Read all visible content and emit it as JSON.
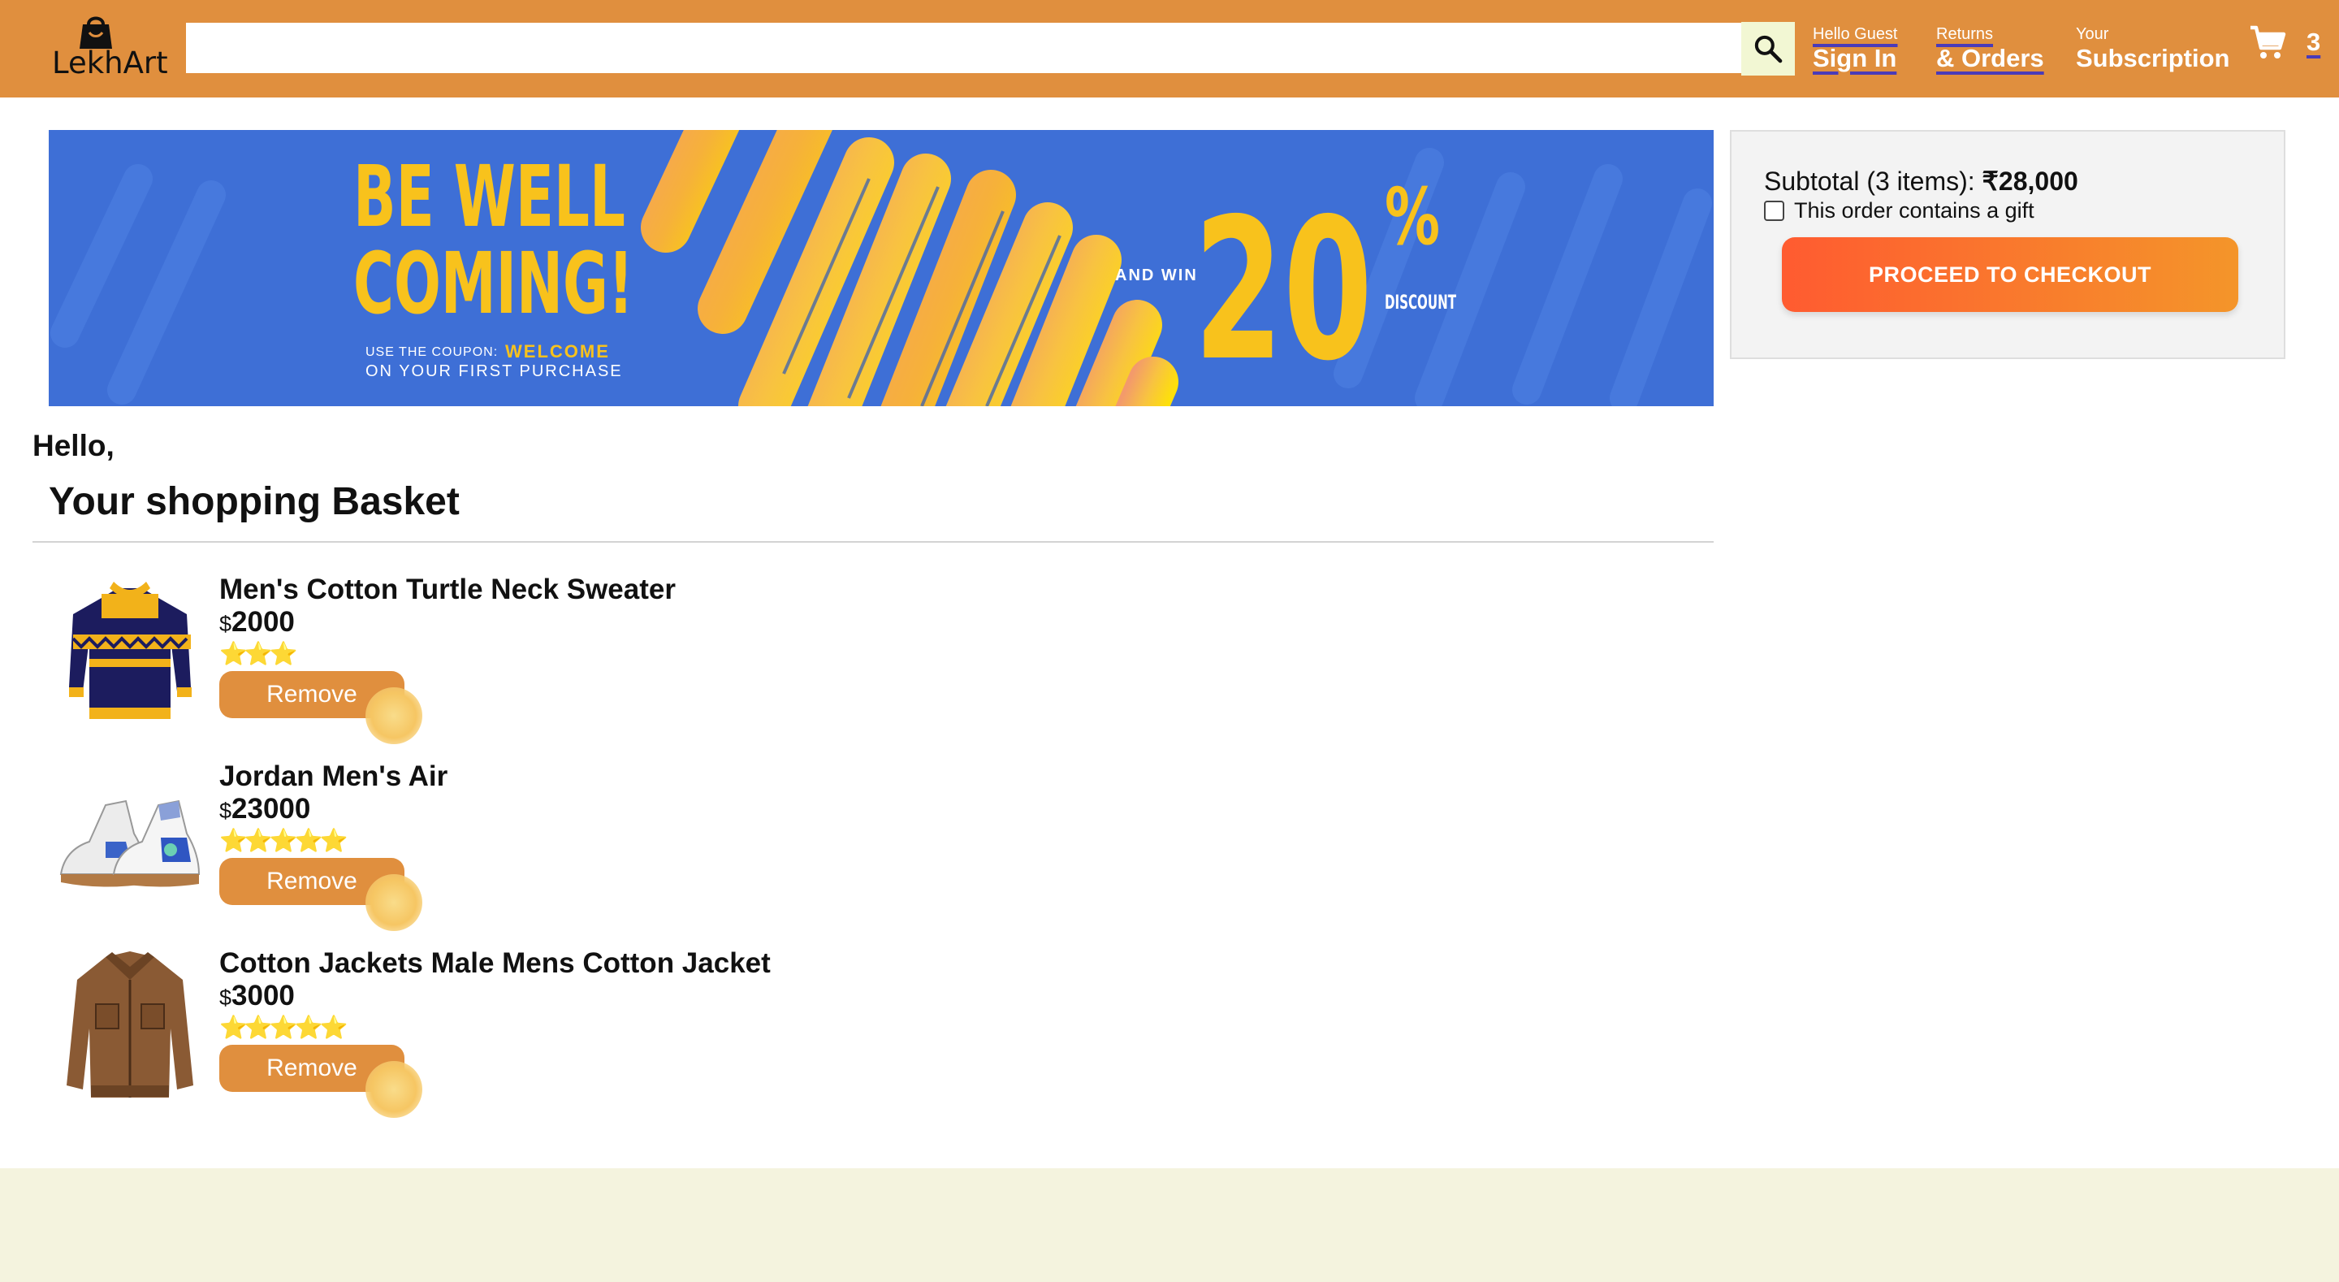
{
  "header": {
    "logo_text": "LekhArt",
    "search": {
      "value": "",
      "placeholder": ""
    },
    "nav": [
      {
        "small": "Hello Guest",
        "big": "Sign In"
      },
      {
        "small": "Returns",
        "big": "& Orders"
      },
      {
        "small": "Your",
        "big": "Subscription"
      }
    ],
    "cart_count": "3"
  },
  "banner": {
    "line1": "BE WELL",
    "line2": "COMING!",
    "coupon_prefix": "USE THE COUPON:",
    "coupon_code": "WELCOME",
    "coupon_suffix": "ON YOUR FIRST PURCHASE",
    "and_win": "AND WIN",
    "percent_value": "20",
    "percent_sign": "%",
    "discount": "DISCOUNT"
  },
  "subtotal": {
    "label": "Subtotal (3 items):",
    "amount": "₹28,000",
    "gift_label": "This order contains a gift",
    "checkout_label": "PROCEED TO CHECKOUT"
  },
  "greeting": "Hello,",
  "basket_title": "Your shopping Basket",
  "items": [
    {
      "title": "Men's Cotton Turtle Neck Sweater",
      "currency": "$",
      "price": "2000",
      "rating": 3,
      "stars": "⭐⭐⭐",
      "remove_label": "Remove",
      "image": "sweater"
    },
    {
      "title": "Jordan Men's Air",
      "currency": "$",
      "price": "23000",
      "rating": 5,
      "stars": "⭐⭐⭐⭐⭐",
      "remove_label": "Remove",
      "image": "sneakers"
    },
    {
      "title": "Cotton Jackets Male Mens Cotton Jacket",
      "currency": "$",
      "price": "3000",
      "rating": 5,
      "stars": "⭐⭐⭐⭐⭐",
      "remove_label": "Remove",
      "image": "jacket"
    }
  ],
  "colors": {
    "header": "#e08f3e",
    "accent_underline": "#4a3bb8",
    "checkout_start": "#ff5b30",
    "checkout_end": "#f4952a",
    "footer": "#f4f3de",
    "banner_blue": "#3e6fd6",
    "banner_yellow": "#f8c21c"
  },
  "icons": {
    "logo": "shopping-bag-icon",
    "search": "search-icon",
    "cart": "cart-icon"
  }
}
